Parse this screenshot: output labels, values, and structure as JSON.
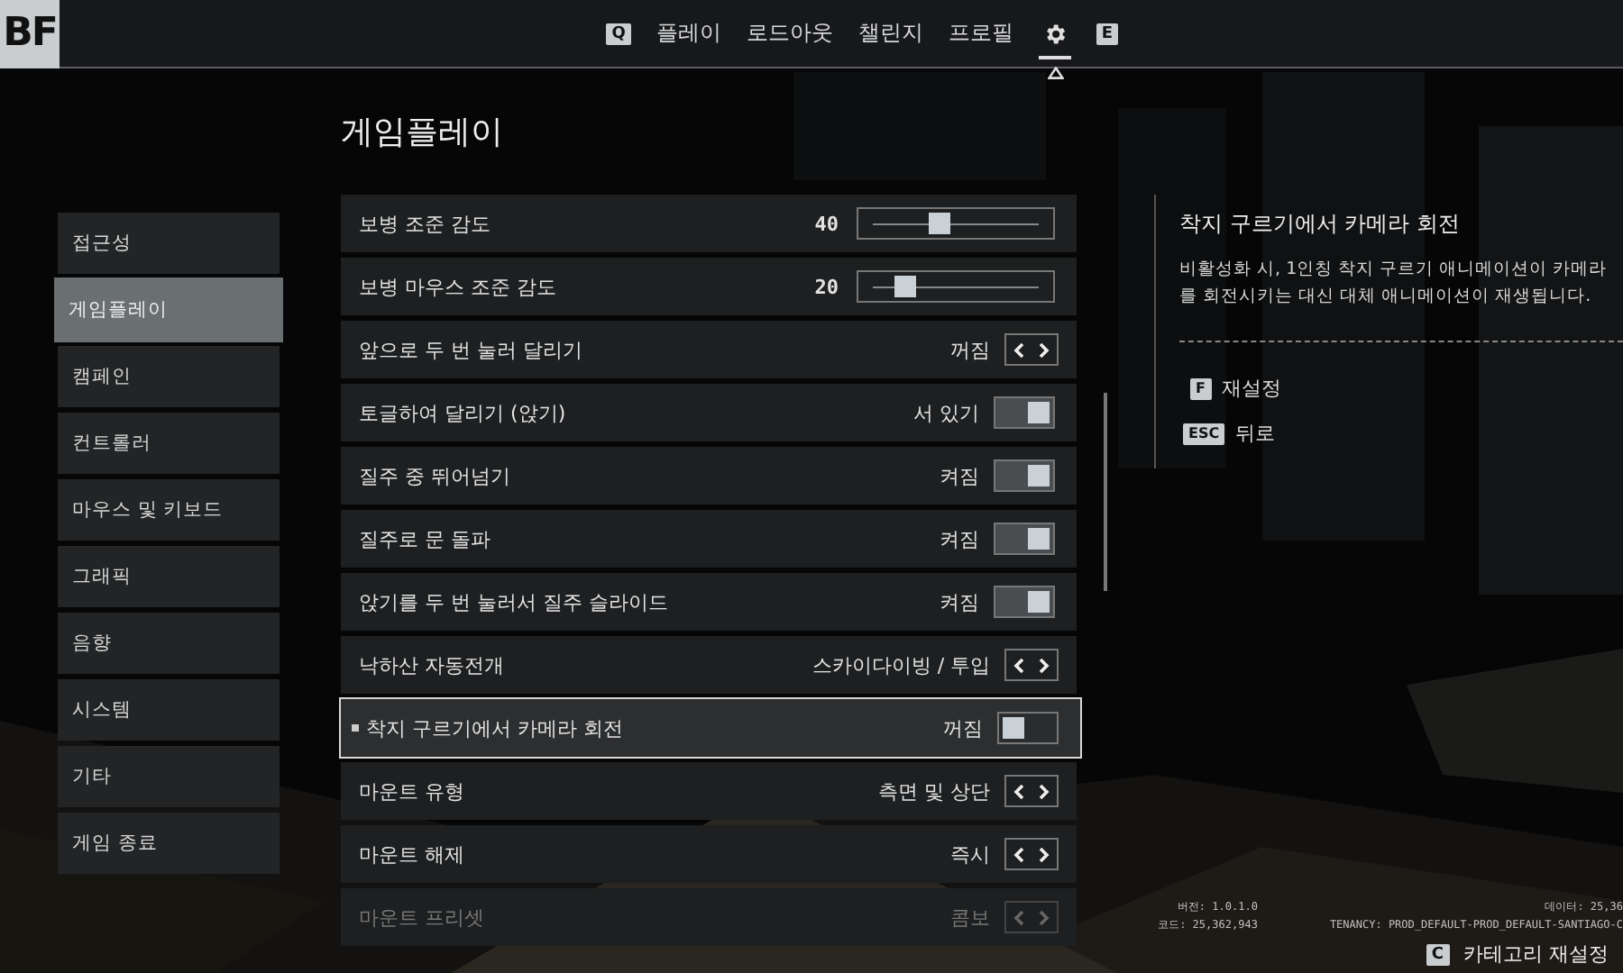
{
  "logo": "BF",
  "nav": {
    "prev_key": "Q",
    "next_key": "E",
    "tabs": [
      {
        "kind": "text",
        "label": "플레이",
        "selected": false
      },
      {
        "kind": "text",
        "label": "로드아웃",
        "selected": false
      },
      {
        "kind": "text",
        "label": "챌린지",
        "selected": false
      },
      {
        "kind": "text",
        "label": "프로필",
        "selected": false
      },
      {
        "kind": "settings",
        "selected": true
      }
    ]
  },
  "page_title": "게임플레이",
  "categories": [
    {
      "label": "접근성",
      "selected": false
    },
    {
      "label": "게임플레이",
      "selected": true
    },
    {
      "label": "캠페인",
      "selected": false
    },
    {
      "label": "컨트롤러",
      "selected": false
    },
    {
      "label": "마우스 및 키보드",
      "selected": false
    },
    {
      "label": "그래픽",
      "selected": false
    },
    {
      "label": "음향",
      "selected": false
    },
    {
      "label": "시스템",
      "selected": false
    },
    {
      "label": "기타",
      "selected": false
    },
    {
      "label": "게임 종료",
      "selected": false
    }
  ],
  "settings": [
    {
      "kind": "slider",
      "label": "보병 조준 감도",
      "value": "40",
      "level": 0.4,
      "selected": false,
      "disabled": false
    },
    {
      "kind": "slider",
      "label": "보병 마우스 조준 감도",
      "value": "20",
      "level": 0.2,
      "selected": false,
      "disabled": false
    },
    {
      "kind": "cycle",
      "label": "앞으로 두 번 눌러 달리기",
      "value": "꺼짐",
      "selected": false,
      "disabled": false
    },
    {
      "kind": "toggle",
      "label": "토글하여 달리기 (앉기)",
      "value": "서 있기",
      "on": true,
      "selected": false,
      "disabled": false
    },
    {
      "kind": "toggle",
      "label": "질주 중 뛰어넘기",
      "value": "켜짐",
      "on": true,
      "selected": false,
      "disabled": false
    },
    {
      "kind": "toggle",
      "label": "질주로 문 돌파",
      "value": "켜짐",
      "on": true,
      "selected": false,
      "disabled": false
    },
    {
      "kind": "toggle",
      "label": "앉기를 두 번 눌러서 질주 슬라이드",
      "value": "켜짐",
      "on": true,
      "selected": false,
      "disabled": false
    },
    {
      "kind": "cycle",
      "label": "낙하산 자동전개",
      "value": "스카이다이빙 / 투입",
      "selected": false,
      "disabled": false
    },
    {
      "kind": "toggle",
      "label": "착지 구르기에서 카메라 회전",
      "value": "꺼짐",
      "on": false,
      "selected": true,
      "disabled": false
    },
    {
      "kind": "cycle",
      "label": "마운트 유형",
      "value": "측면 및 상단",
      "selected": false,
      "disabled": false
    },
    {
      "kind": "cycle",
      "label": "마운트 해제",
      "value": "즉시",
      "selected": false,
      "disabled": false
    },
    {
      "kind": "cycle",
      "label": "마운트 프리셋",
      "value": "콤보",
      "selected": false,
      "disabled": true
    }
  ],
  "detail": {
    "title": "착지 구르기에서 카메라 회전",
    "description": "비활성화 시, 1인칭 착지 구르기 애니메이션이 카메라를 회전시키는 대신 대체 애니메이션이 재생됩니다."
  },
  "actions": [
    {
      "key": "F",
      "label": "재설정"
    },
    {
      "key": "ESC",
      "label": "뒤로"
    }
  ],
  "build_info": {
    "version": "버전: 1.0.1.0",
    "code": "코드: 25,362,943",
    "data": "데이터: 25,36",
    "tenancy": "TENANCY: PROD_DEFAULT-PROD_DEFAULT-SANTIAGO-C"
  },
  "footer_action": {
    "key": "C",
    "label": "카테고리 재설정"
  }
}
